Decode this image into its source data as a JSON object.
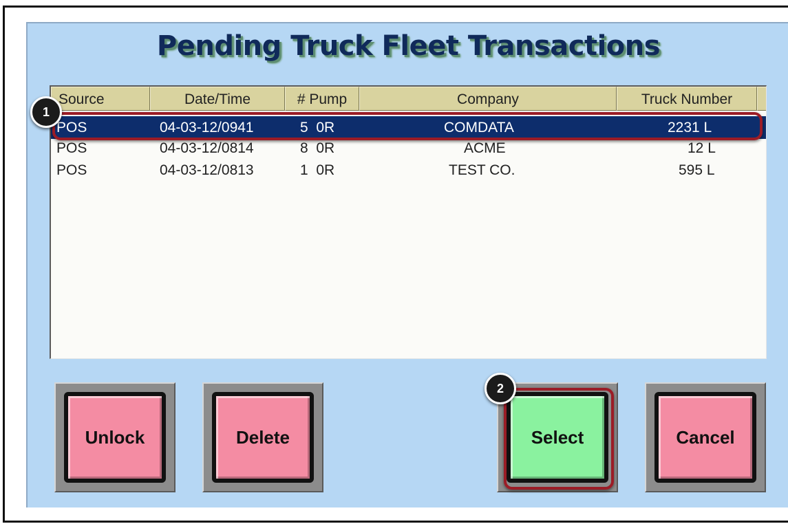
{
  "window": {
    "title": "Pending Truck Fleet Transactions"
  },
  "table": {
    "columns": [
      "Source",
      "Date/Time",
      "# Pump",
      "Company",
      "Truck Number"
    ],
    "rows": [
      {
        "source": "POS",
        "datetime": "04-03-12/0941",
        "pump": "5  0R",
        "company": "COMDATA",
        "truck": "2231 L",
        "selected": true
      },
      {
        "source": "POS",
        "datetime": "04-03-12/0814",
        "pump": "8  0R",
        "company": "ACME",
        "truck": "12 L",
        "selected": false
      },
      {
        "source": "POS",
        "datetime": "04-03-12/0813",
        "pump": "1  0R",
        "company": "TEST CO.",
        "truck": "595 L",
        "selected": false
      }
    ]
  },
  "buttons": {
    "unlock": "Unlock",
    "delete": "Delete",
    "select": "Select",
    "cancel": "Cancel"
  },
  "callouts": {
    "first": "1",
    "second": "2"
  },
  "colors": {
    "dialog_bg": "#b6d7f4",
    "selected_row": "#0d2d6c",
    "header_bg": "#d9d39f",
    "pink_button": "#f48ca3",
    "green_button": "#8af29f",
    "highlight_outline": "#9b1c26"
  }
}
